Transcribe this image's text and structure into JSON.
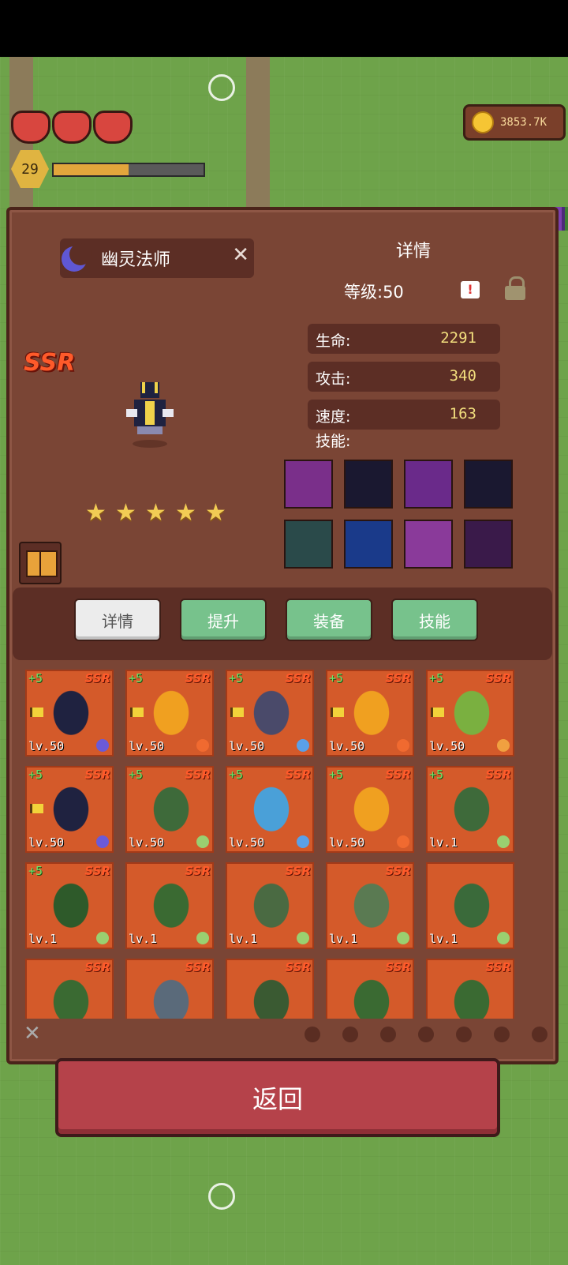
{
  "hud": {
    "coins": "3853.7K",
    "player_level": "29",
    "hearts": 3,
    "xp_fraction": 0.5
  },
  "hero": {
    "name": "幽灵法师",
    "rarity": "SSR",
    "stars": 5,
    "detail_title": "详情",
    "level_label": "等级:50",
    "stats": [
      {
        "label": "生命:",
        "value": "2291"
      },
      {
        "label": "攻击:",
        "value": "340"
      },
      {
        "label": "速度:",
        "value": "163"
      }
    ],
    "skills_label": "技能:",
    "skill_icons": [
      "skull-skill-icon",
      "crosshair-skill-icon",
      "eye-skill-icon",
      "bone-skill-icon",
      "poison-skull-skill-icon",
      "arrow-skill-icon",
      "mask-skill-icon",
      "shadow-skill-icon"
    ]
  },
  "tabs": [
    {
      "label": "详情",
      "active": true
    },
    {
      "label": "提升",
      "active": false
    },
    {
      "label": "装备",
      "active": false
    },
    {
      "label": "技能",
      "active": false
    }
  ],
  "cards": [
    {
      "plus": "+5",
      "ssr": "SSR",
      "lv": "lv.50",
      "flag": true,
      "color": "#1f2240",
      "elem": "#6a5ad8"
    },
    {
      "plus": "+5",
      "ssr": "SSR",
      "lv": "lv.50",
      "flag": true,
      "color": "#f0a020",
      "elem": "#f06a30"
    },
    {
      "plus": "+5",
      "ssr": "SSR",
      "lv": "lv.50",
      "flag": true,
      "color": "#4a4a6a",
      "elem": "#5aa0e8"
    },
    {
      "plus": "+5",
      "ssr": "SSR",
      "lv": "lv.50",
      "flag": true,
      "color": "#f0a020",
      "elem": "#f06a30"
    },
    {
      "plus": "+5",
      "ssr": "SSR",
      "lv": "lv.50",
      "flag": true,
      "color": "#7ab040",
      "elem": "#f0a040"
    },
    {
      "plus": "+5",
      "ssr": "SSR",
      "lv": "lv.50",
      "flag": true,
      "color": "#1f2240",
      "elem": "#6a5ad8"
    },
    {
      "plus": "+5",
      "ssr": "SSR",
      "lv": "lv.50",
      "flag": false,
      "color": "#3e6a3a",
      "elem": "#9ad070"
    },
    {
      "plus": "+5",
      "ssr": "SSR",
      "lv": "lv.50",
      "flag": false,
      "color": "#4aa0d8",
      "elem": "#5aa0e8"
    },
    {
      "plus": "+5",
      "ssr": "SSR",
      "lv": "lv.50",
      "flag": false,
      "color": "#f0a020",
      "elem": "#f06a30"
    },
    {
      "plus": "+5",
      "ssr": "SSR",
      "lv": "lv.1",
      "flag": false,
      "color": "#3e6a3a",
      "elem": "#9ad070"
    },
    {
      "plus": "+5",
      "ssr": "SSR",
      "lv": "lv.1",
      "flag": false,
      "color": "#2e5a2a",
      "elem": "#9ad070"
    },
    {
      "plus": "",
      "ssr": "SSR",
      "lv": "lv.1",
      "flag": false,
      "color": "#3a6a32",
      "elem": "#9ad070"
    },
    {
      "plus": "",
      "ssr": "SSR",
      "lv": "lv.1",
      "flag": false,
      "color": "#4a6a42",
      "elem": "#9ad070"
    },
    {
      "plus": "",
      "ssr": "SSR",
      "lv": "lv.1",
      "flag": false,
      "color": "#5a7a52",
      "elem": "#9ad070"
    },
    {
      "plus": "",
      "ssr": "",
      "lv": "lv.1",
      "flag": false,
      "color": "#3a6a3a",
      "elem": "#9ad070"
    },
    {
      "plus": "",
      "ssr": "SSR",
      "lv": "",
      "flag": false,
      "color": "#3a6a32",
      "elem": ""
    },
    {
      "plus": "",
      "ssr": "SSR",
      "lv": "",
      "flag": false,
      "color": "#5a6a7a",
      "elem": ""
    },
    {
      "plus": "",
      "ssr": "SSR",
      "lv": "",
      "flag": false,
      "color": "#3a5a32",
      "elem": ""
    },
    {
      "plus": "",
      "ssr": "SSR",
      "lv": "",
      "flag": false,
      "color": "#3a6a32",
      "elem": ""
    },
    {
      "plus": "",
      "ssr": "SSR",
      "lv": "",
      "flag": false,
      "color": "#3a6a32",
      "elem": ""
    }
  ],
  "filter_icons": [
    "leaf-filter-icon",
    "drop-filter-icon",
    "water-filter-icon",
    "tornado-filter-icon",
    "fire-filter-icon",
    "sun-filter-icon",
    "moon-filter-icon"
  ],
  "back_button": "返回",
  "colors": {
    "panel": "#7a4535",
    "card": "#d45a2a",
    "tab_green": "#77c28c",
    "back_button": "#b5424a",
    "ssr": "#ff5a2a"
  }
}
